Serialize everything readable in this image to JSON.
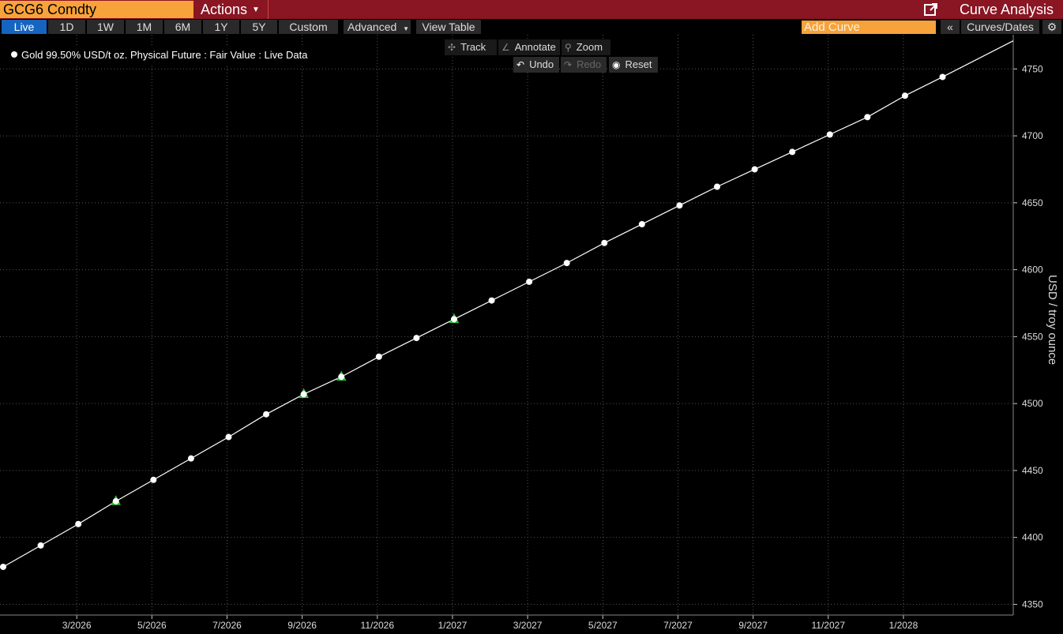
{
  "header": {
    "ticker": "GCG6 Comdty",
    "actions_label": "Actions",
    "app_title": "Curve Analysis"
  },
  "toolbar": {
    "ranges": [
      "Live",
      "1D",
      "1W",
      "1M",
      "6M",
      "1Y",
      "5Y",
      "Custom"
    ],
    "active_range": "Live",
    "advanced_label": "Advanced",
    "view_table_label": "View Table",
    "add_curve_placeholder": "Add Curve",
    "curves_dates_label": "Curves/Dates"
  },
  "chart_tools": {
    "track": "Track",
    "annotate": "Annotate",
    "zoom": "Zoom",
    "undo": "Undo",
    "redo": "Redo",
    "reset": "Reset"
  },
  "legend": {
    "series_label": "Gold 99.50% USD/t oz. Physical Future : Fair Value : Live Data"
  },
  "colors": {
    "title_bar": "#8a1523",
    "ticker_bg": "#f7a23a",
    "active_tab": "#1565c0",
    "series": "#ffffff",
    "marker_triangle": "#2ecc40"
  },
  "chart_data": {
    "type": "line",
    "ylabel": "USD / troy ounce",
    "ylim": [
      4342,
      4772
    ],
    "y_ticks": [
      4350,
      4400,
      4450,
      4500,
      4550,
      4600,
      4650,
      4700,
      4750
    ],
    "x_ticks": [
      "3/2026",
      "5/2026",
      "7/2026",
      "9/2026",
      "11/2026",
      "1/2027",
      "3/2027",
      "5/2027",
      "7/2027",
      "9/2027",
      "11/2027",
      "1/2028"
    ],
    "grid": true,
    "legend_position": "top-left",
    "series": [
      {
        "name": "Gold 99.50% USD/t oz. Physical Future : Fair Value : Live Data",
        "x": [
          "2026-01",
          "2026-02",
          "2026-03",
          "2026-04",
          "2026-05",
          "2026-06",
          "2026-07",
          "2026-08",
          "2026-09",
          "2026-10",
          "2026-11",
          "2026-12",
          "2027-01",
          "2027-02",
          "2027-03",
          "2027-04",
          "2027-05",
          "2027-06",
          "2027-07",
          "2027-08",
          "2027-09",
          "2027-10",
          "2027-11",
          "2027-12",
          "2028-01",
          "2028-02"
        ],
        "values": [
          4378,
          4394,
          4410,
          4427,
          4443,
          4459,
          4475,
          4492,
          4507,
          4520,
          4535,
          4549,
          4563,
          4577,
          4591,
          4605,
          4620,
          4634,
          4648,
          4662,
          4675,
          4688,
          4701,
          4714,
          4730,
          4744
        ],
        "triangle_markers": [
          "2026-04",
          "2026-09",
          "2026-10",
          "2027-01"
        ]
      }
    ],
    "line_extends_to": 4771
  }
}
